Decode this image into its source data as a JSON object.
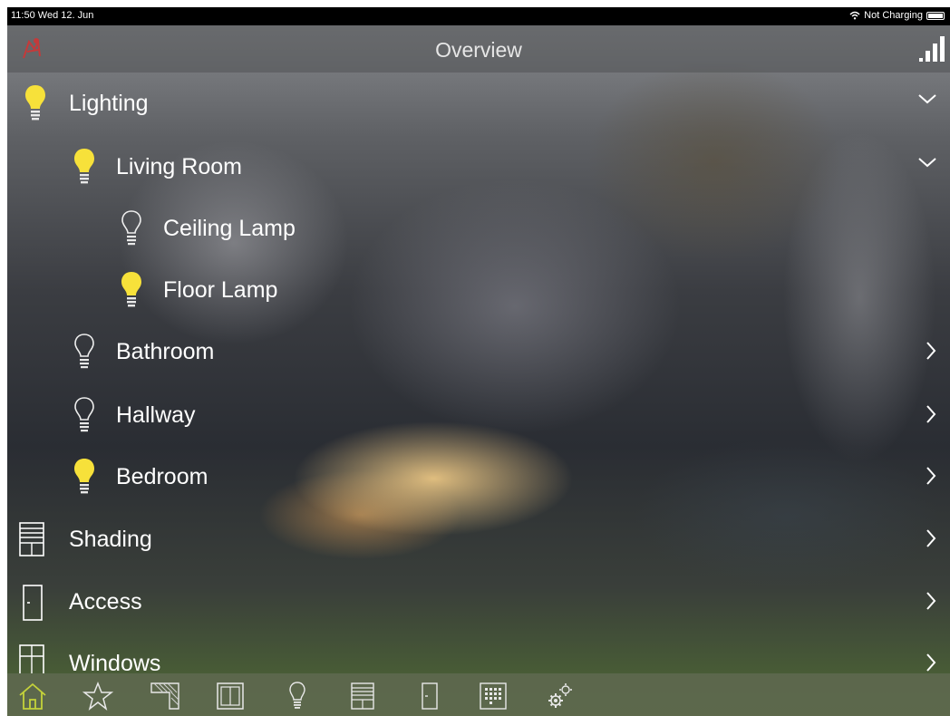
{
  "status_bar": {
    "time": "11:50",
    "date": "Wed 12. Jun",
    "charging_status": "Not Charging",
    "icons": [
      "wifi-icon",
      "battery-icon"
    ]
  },
  "navbar": {
    "title": "Overview",
    "logo_icon": "brand-logo-icon",
    "signal_icon": "signal-strength-icon"
  },
  "list": {
    "items": [
      {
        "label": "Lighting",
        "icon": "bulb-on-icon",
        "chevron": "chevron-down-icon"
      },
      {
        "label": "Living Room",
        "icon": "bulb-on-icon",
        "chevron": "chevron-down-icon"
      },
      {
        "label": "Ceiling Lamp",
        "icon": "bulb-off-icon"
      },
      {
        "label": "Floor Lamp",
        "icon": "bulb-on-icon"
      },
      {
        "label": "Bathroom",
        "icon": "bulb-off-icon",
        "chevron": "chevron-right-icon"
      },
      {
        "label": "Hallway",
        "icon": "bulb-off-icon",
        "chevron": "chevron-right-icon"
      },
      {
        "label": "Bedroom",
        "icon": "bulb-on-icon",
        "chevron": "chevron-right-icon"
      },
      {
        "label": "Shading",
        "icon": "shading-icon",
        "chevron": "chevron-right-icon"
      },
      {
        "label": "Access",
        "icon": "door-icon",
        "chevron": "chevron-right-icon"
      },
      {
        "label": "Windows",
        "icon": "window-icon",
        "chevron": "chevron-right-icon"
      }
    ]
  },
  "tab_bar": {
    "tabs": [
      "home-icon",
      "favorites-star-icon",
      "blinds-icon",
      "window-icon",
      "lighting-bulb-icon",
      "shading-icon",
      "door-icon",
      "keypad-icon",
      "settings-gear-icon"
    ],
    "active_tab": "home-icon"
  },
  "colors": {
    "bulb_on": "#f7e13a",
    "accent_active": "#c4d23a",
    "text": "#ffffff",
    "logo_red": "#c43a3a"
  }
}
